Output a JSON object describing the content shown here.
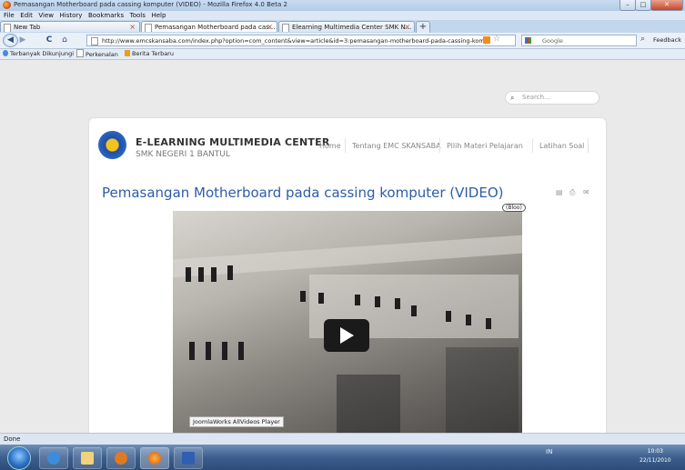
{
  "window": {
    "title": "Pemasangan Motherboard pada cassing komputer (VIDEO) - Mozilla Firefox 4.0 Beta 2",
    "min": "–",
    "max": "□",
    "close": "✕"
  },
  "menu": [
    "File",
    "Edit",
    "View",
    "History",
    "Bookmarks",
    "Tools",
    "Help"
  ],
  "tabs": [
    {
      "label": "New Tab",
      "close": "×"
    },
    {
      "label": "Pemasangan Motherboard pada cas...",
      "close": "×"
    },
    {
      "label": "Elearning Multimedia Center SMK N...",
      "close": "×"
    }
  ],
  "newtab": "+",
  "nav": {
    "back": "◀",
    "forward": "▶",
    "reload": "C",
    "home": "⌂",
    "url": "http://www.emcskansaba.com/index.php?option=com_content&view=article&id=3:pemasangan-motherboard-pada-cassing-komp",
    "search_engine": "Google",
    "feedback": "Feedback"
  },
  "bookmarks": [
    "Terbanyak Dikunjungi",
    "Perkenalan",
    "Berita Terbaru"
  ],
  "site": {
    "search_placeholder": "Search...",
    "name": "E-LEARNING MULTIMEDIA CENTER",
    "subtitle": "SMK NEGERI 1 BANTUL",
    "nav": [
      "Home",
      "Tentang EMC SKANSABA",
      "Pilih Materi Pelajaran",
      "Latihan Soal"
    ]
  },
  "article": {
    "title": "Pemasangan Motherboard pada cassing komputer (VIDEO)",
    "tools": [
      "▤",
      "⎙",
      "✉"
    ],
    "video_label": "JoomlaWorks AllVideos Player",
    "video_badge": "(Bloo)"
  },
  "status": "Done",
  "taskbar": {
    "clock_time": "10:03",
    "clock_date": "22/11/2010",
    "tray": "IN"
  },
  "colors": {
    "link": "#2d5da8",
    "page_bg": "#eaeaea"
  }
}
